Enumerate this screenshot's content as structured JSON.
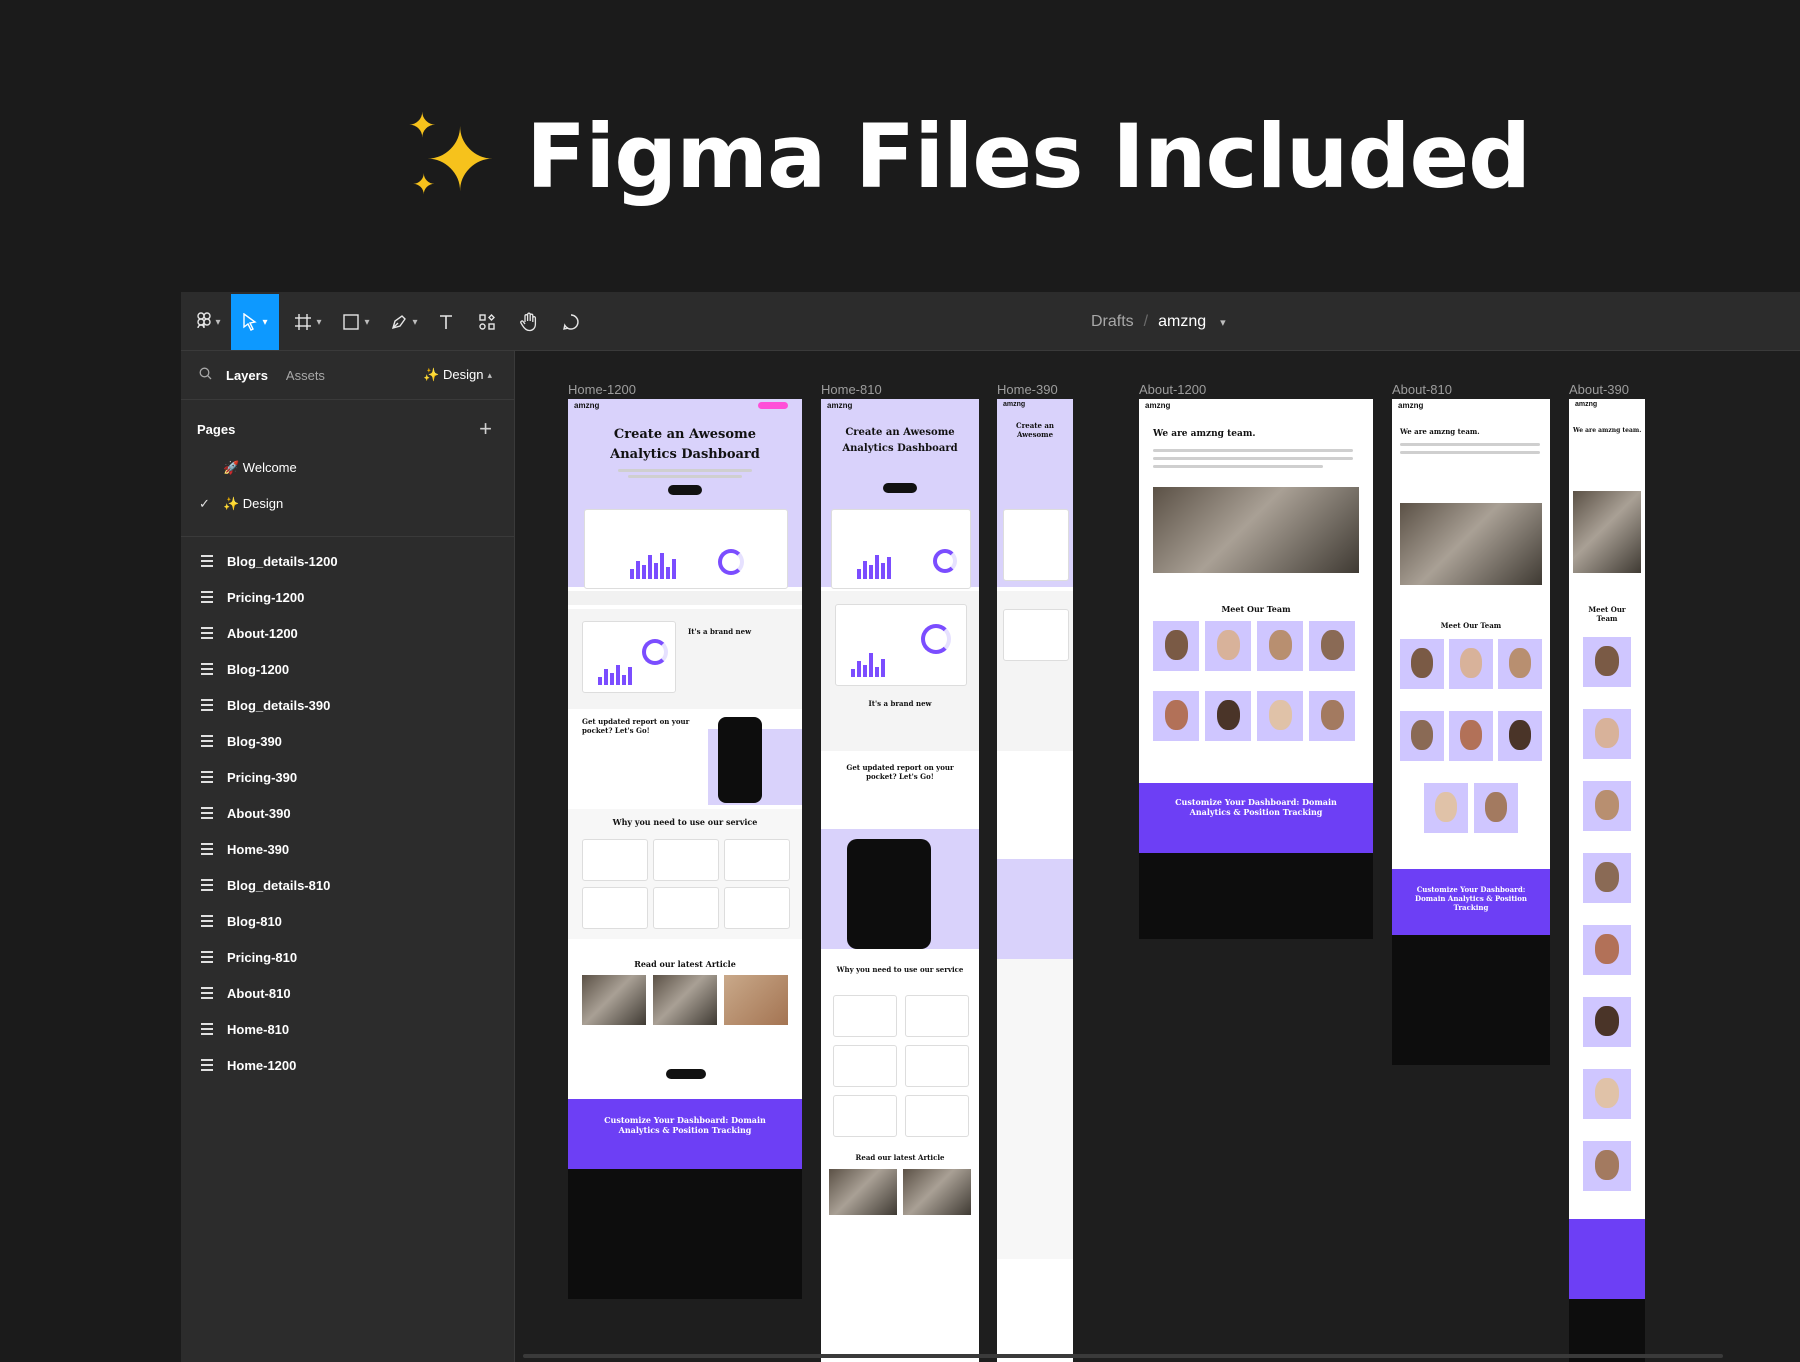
{
  "hero": {
    "title": "Figma Files Included",
    "icon": "sparkles-icon"
  },
  "toolbar": {
    "tools": [
      "figma-menu-icon",
      "move-tool-icon",
      "frame-tool-icon",
      "shape-tool-icon",
      "pen-tool-icon",
      "text-tool-icon",
      "components-icon",
      "hand-tool-icon",
      "comment-icon"
    ],
    "breadcrumb": {
      "drafts": "Drafts",
      "separator": "/",
      "file": "amzng"
    },
    "active_color": "#0d99ff"
  },
  "sidebar": {
    "tabs": {
      "layers": "Layers",
      "assets": "Assets"
    },
    "design_label": "✨ Design",
    "pages_header": "Pages",
    "pages": [
      {
        "label": "🚀 Welcome",
        "checked": false
      },
      {
        "label": "✨ Design",
        "checked": true
      }
    ],
    "layers": [
      "Blog_details-1200",
      "Pricing-1200",
      "About-1200",
      "Blog-1200",
      "Blog_details-390",
      "Blog-390",
      "Pricing-390",
      "About-390",
      "Home-390",
      "Blog_details-810",
      "Blog-810",
      "Pricing-810",
      "About-810",
      "Home-810",
      "Home-1200"
    ]
  },
  "canvas": {
    "frames": {
      "home1200": "Home-1200",
      "home810": "Home-810",
      "home390": "Home-390",
      "about1200": "About-1200",
      "about810": "About-810",
      "about390": "About-390"
    },
    "content": {
      "logo": "amzng",
      "hero_line1": "Create an Awesome",
      "hero_line2": "Analytics Dashboard",
      "brand_new": "It's a brand new",
      "report": "Get updated report on your pocket? Let's Go!",
      "why": "Why you need to use our service",
      "latest": "Read our latest Article",
      "cta": "Customize Your Dashboard: Domain Analytics & Position Tracking",
      "about_title": "We are amzng team.",
      "meet_team": "Meet Our Team",
      "meet_team_short": "Meet Our Team"
    },
    "brand_colors": {
      "lavender": "#d9d2fb",
      "violet": "#6d3ff5",
      "pink": "#ff4fd8"
    }
  }
}
